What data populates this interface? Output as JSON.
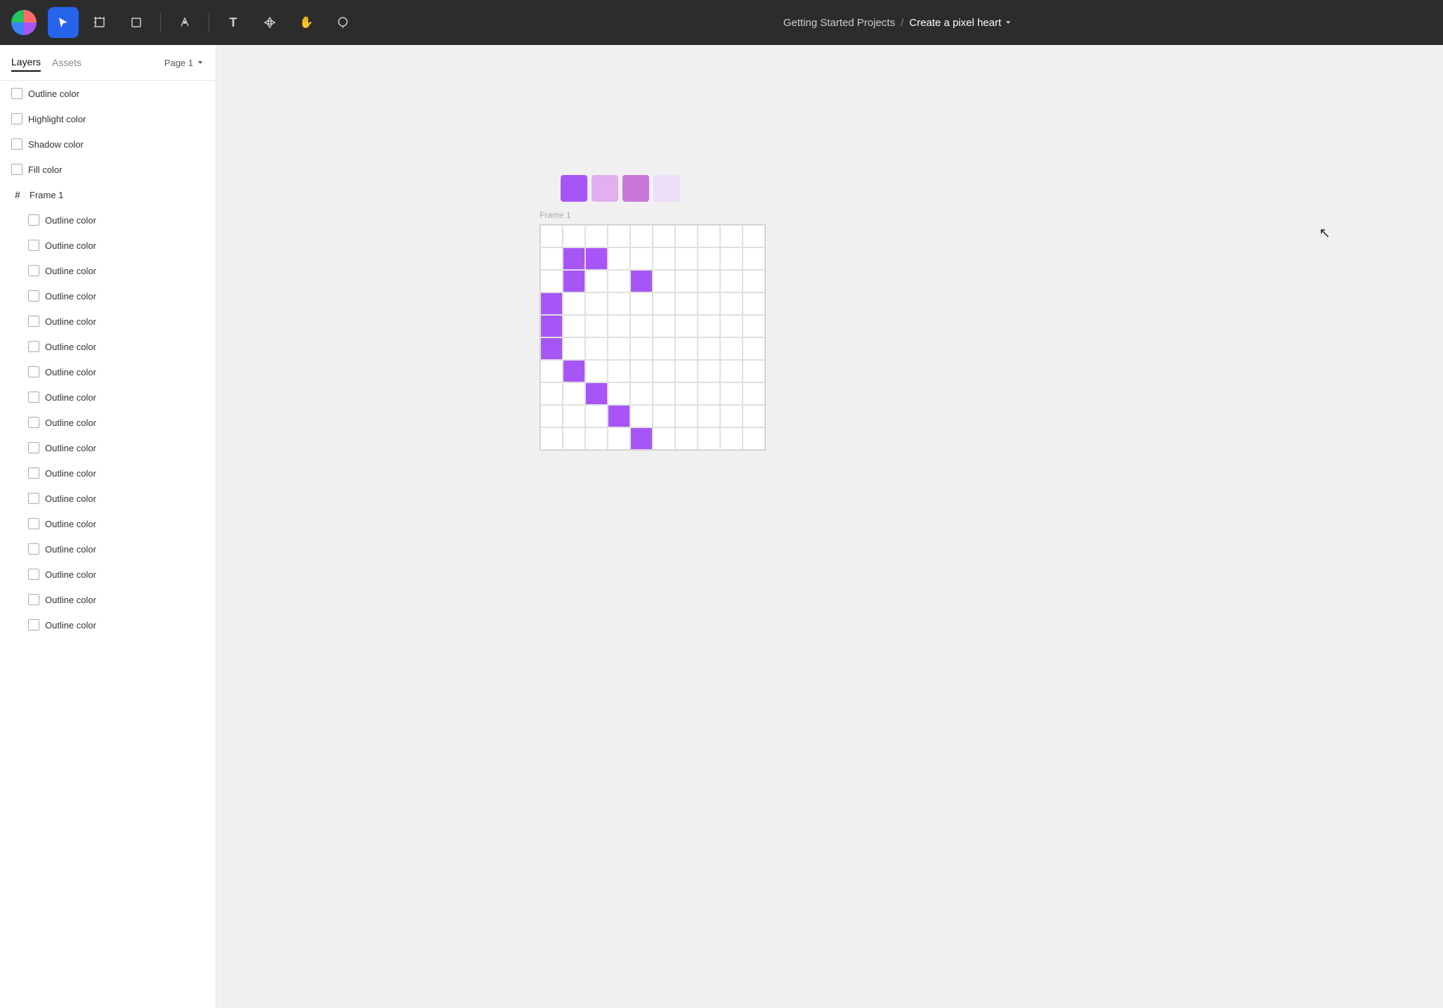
{
  "toolbar": {
    "title": "Getting Started Projects",
    "separator": "/",
    "project": "Create a pixel heart",
    "tools": [
      {
        "name": "figma-menu",
        "icon": "",
        "active": false
      },
      {
        "name": "select-tool",
        "icon": "▶",
        "active": true
      },
      {
        "name": "frame-tool",
        "icon": "⊞",
        "active": false
      },
      {
        "name": "shape-tool",
        "icon": "□",
        "active": false
      },
      {
        "name": "pen-tool",
        "icon": "✒",
        "active": false
      },
      {
        "name": "text-tool",
        "icon": "T",
        "active": false
      },
      {
        "name": "component-tool",
        "icon": "❋",
        "active": false
      },
      {
        "name": "hand-tool",
        "icon": "✋",
        "active": false
      },
      {
        "name": "comment-tool",
        "icon": "◯",
        "active": false
      }
    ]
  },
  "sidebar": {
    "tabs": [
      {
        "name": "Layers",
        "active": true
      },
      {
        "name": "Assets",
        "active": false
      }
    ],
    "page": "Page 1",
    "layers": [
      {
        "type": "rect",
        "label": "Outline color",
        "indent": false
      },
      {
        "type": "rect",
        "label": "Highlight color",
        "indent": false
      },
      {
        "type": "rect",
        "label": "Shadow color",
        "indent": false
      },
      {
        "type": "rect",
        "label": "Fill color",
        "indent": false
      },
      {
        "type": "frame",
        "label": "Frame 1",
        "indent": false
      },
      {
        "type": "rect",
        "label": "Outline color",
        "indent": true
      },
      {
        "type": "rect",
        "label": "Outline color",
        "indent": true
      },
      {
        "type": "rect",
        "label": "Outline color",
        "indent": true
      },
      {
        "type": "rect",
        "label": "Outline color",
        "indent": true
      },
      {
        "type": "rect",
        "label": "Outline color",
        "indent": true
      },
      {
        "type": "rect",
        "label": "Outline color",
        "indent": true
      },
      {
        "type": "rect",
        "label": "Outline color",
        "indent": true
      },
      {
        "type": "rect",
        "label": "Outline color",
        "indent": true
      },
      {
        "type": "rect",
        "label": "Outline color",
        "indent": true
      },
      {
        "type": "rect",
        "label": "Outline color",
        "indent": true
      },
      {
        "type": "rect",
        "label": "Outline color",
        "indent": true
      },
      {
        "type": "rect",
        "label": "Outline color",
        "indent": true
      },
      {
        "type": "rect",
        "label": "Outline color",
        "indent": true
      },
      {
        "type": "rect",
        "label": "Outline color",
        "indent": true
      },
      {
        "type": "rect",
        "label": "Outline color",
        "indent": true
      },
      {
        "type": "rect",
        "label": "Outline color",
        "indent": true
      },
      {
        "type": "rect",
        "label": "Outline color",
        "indent": true
      }
    ]
  },
  "canvas": {
    "frame_label": "Frame 1",
    "swatches": [
      {
        "color": "#a855f7"
      },
      {
        "color": "#d8a0e8"
      },
      {
        "color": "#c070d0"
      },
      {
        "color": "#e8c8f0"
      }
    ],
    "grid": {
      "cols": 10,
      "rows": 10,
      "cells": [
        [
          null,
          null,
          null,
          null,
          null,
          null,
          null,
          null,
          null,
          null
        ],
        [
          null,
          "#a855f7",
          "#a855f7",
          null,
          null,
          null,
          null,
          null,
          null,
          null
        ],
        [
          null,
          "#a855f7",
          null,
          null,
          "#a855f7",
          null,
          null,
          null,
          null,
          null
        ],
        [
          "#a855f7",
          null,
          null,
          null,
          null,
          null,
          null,
          null,
          null,
          null
        ],
        [
          "#a855f7",
          null,
          null,
          null,
          null,
          null,
          null,
          null,
          null,
          null
        ],
        [
          "#a855f7",
          null,
          null,
          null,
          null,
          null,
          null,
          null,
          null,
          null
        ],
        [
          null,
          "#a855f7",
          null,
          null,
          null,
          null,
          null,
          null,
          null,
          null
        ],
        [
          null,
          null,
          "#a855f7",
          null,
          null,
          null,
          null,
          null,
          null,
          null
        ],
        [
          null,
          null,
          null,
          "#a855f7",
          null,
          null,
          null,
          null,
          null,
          null
        ],
        [
          null,
          null,
          null,
          null,
          "#a855f7",
          null,
          null,
          null,
          null,
          null
        ]
      ]
    }
  }
}
